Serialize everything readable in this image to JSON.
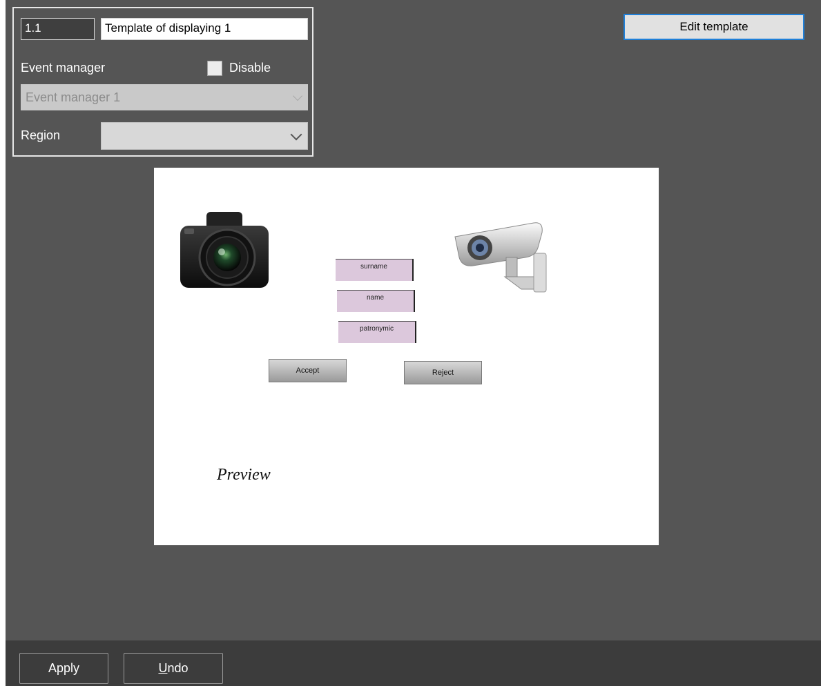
{
  "properties": {
    "id_value": "1.1",
    "name_value": "Template of displaying 1",
    "event_manager_label": "Event manager",
    "disable_label": "Disable",
    "event_manager_selected": "Event manager 1",
    "region_label": "Region",
    "region_selected": ""
  },
  "toolbar": {
    "edit_template_label": "Edit template"
  },
  "preview": {
    "fields": [
      "surname",
      "name",
      "patronymic"
    ],
    "accept_label": "Accept",
    "reject_label": "Reject",
    "caption": "Preview"
  },
  "footer": {
    "apply_label": "Apply",
    "undo_label": "Undo"
  }
}
